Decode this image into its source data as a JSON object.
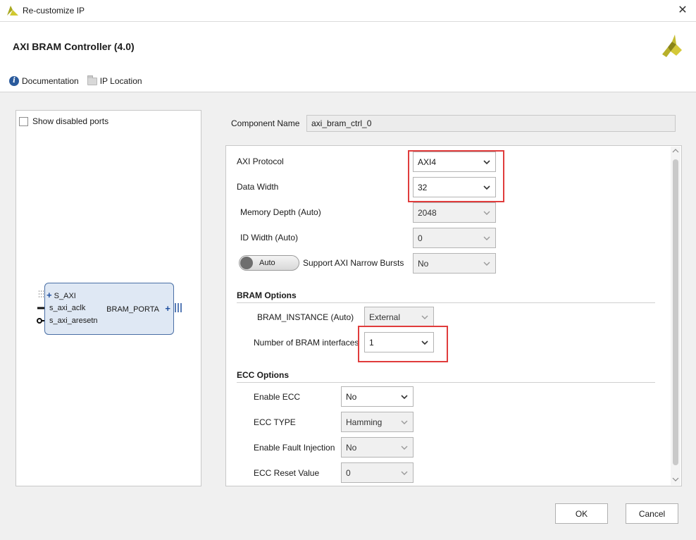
{
  "window": {
    "title": "Re-customize IP",
    "close_glyph": "✕"
  },
  "header": {
    "ip_name": "AXI BRAM Controller (4.0)",
    "links": {
      "documentation": "Documentation",
      "ip_location": "IP Location"
    }
  },
  "left_panel": {
    "show_disabled_ports": "Show disabled ports",
    "block": {
      "s_axi": "S_AXI",
      "s_axi_aclk": "s_axi_aclk",
      "s_axi_aresetn": "s_axi_aresetn",
      "bram_porta": "BRAM_PORTA"
    }
  },
  "component": {
    "label": "Component Name",
    "value": "axi_bram_ctrl_0"
  },
  "params": {
    "axi_protocol": {
      "label": "AXI Protocol",
      "value": "AXI4"
    },
    "data_width": {
      "label": "Data Width",
      "value": "32"
    },
    "memory_depth": {
      "label": "Memory Depth (Auto)",
      "value": "2048"
    },
    "id_width": {
      "label": "ID Width (Auto)",
      "value": "0"
    },
    "narrow_bursts": {
      "toggle": "Auto",
      "label": "Support AXI Narrow Bursts",
      "value": "No"
    },
    "bram_options": {
      "title": "BRAM Options",
      "instance": {
        "label": "BRAM_INSTANCE (Auto)",
        "value": "External"
      },
      "interfaces": {
        "label": "Number of BRAM interfaces",
        "value": "1"
      }
    },
    "ecc_options": {
      "title": "ECC Options",
      "enable_ecc": {
        "label": "Enable ECC",
        "value": "No"
      },
      "ecc_type": {
        "label": "ECC TYPE",
        "value": "Hamming"
      },
      "fault_injection": {
        "label": "Enable Fault Injection",
        "value": "No"
      },
      "reset_value": {
        "label": "ECC Reset Value",
        "value": "0"
      }
    }
  },
  "footer": {
    "ok": "OK",
    "cancel": "Cancel"
  },
  "colors": {
    "highlight": "#e03c3c",
    "brand": "#b8b02a",
    "block_fill": "#dfe8f4"
  }
}
